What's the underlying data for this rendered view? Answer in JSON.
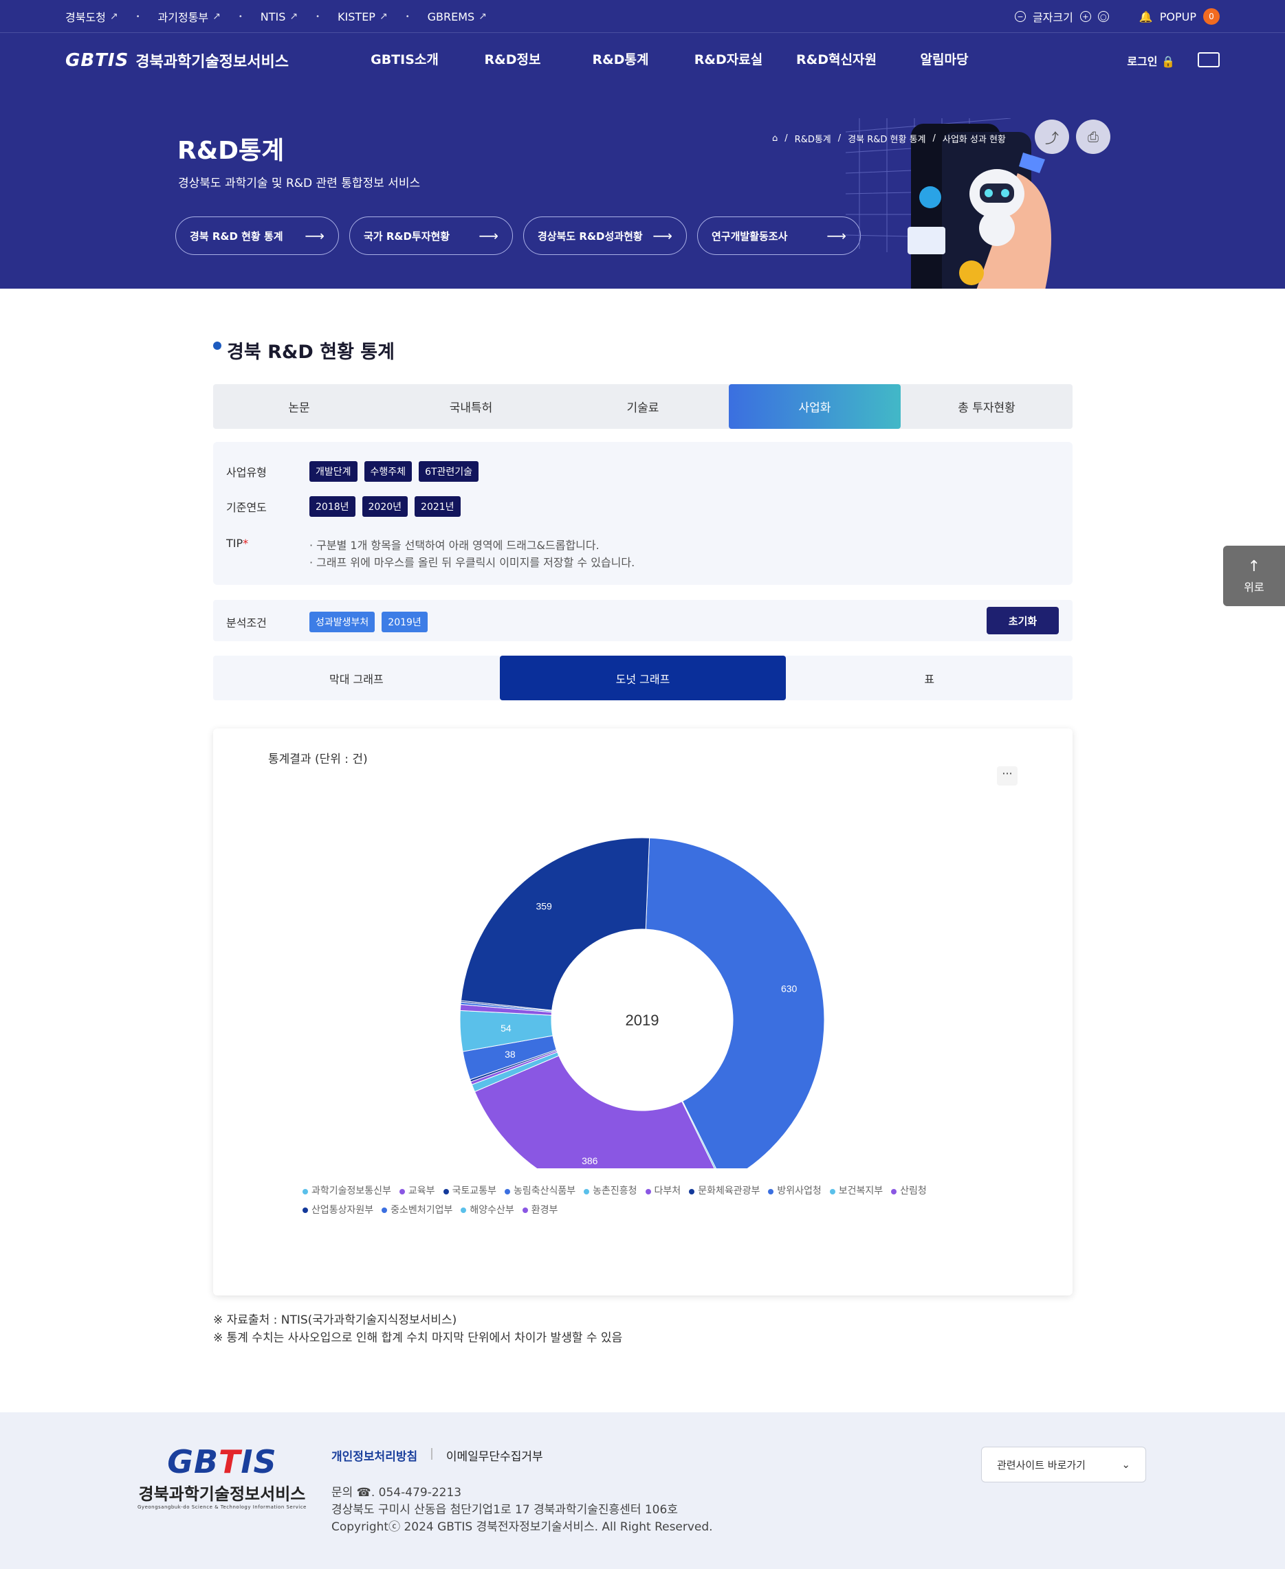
{
  "util_links": [
    "경북도청",
    "과기정통부",
    "NTIS",
    "KISTEP",
    "GBREMS"
  ],
  "font_size_label": "글자크기",
  "popup": {
    "label": "POPUP",
    "count": "0"
  },
  "logo": {
    "mark": "GBTIS",
    "text": "경북과학기술정보서비스"
  },
  "menu": [
    "GBTIS소개",
    "R&D정보",
    "R&D통계",
    "R&D자료실",
    "R&D혁신자원",
    "알림마당"
  ],
  "login": "로그인",
  "hero": {
    "title": "R&D통계",
    "subtitle": "경상북도 과학기술 및 R&D 관련 통합정보 서비스",
    "pills": [
      "경북 R&D 현황 통계",
      "국가 R&D투자현황",
      "경상북도 R&D성과현황",
      "연구개발활동조사"
    ],
    "breadcrumb": [
      "R&D통계",
      "경북 R&D 현황 통계",
      "사업화 성과 현황"
    ]
  },
  "section_title": "경북 R&D 현황 통계",
  "tabs": [
    "논문",
    "국내특허",
    "기술료",
    "사업화",
    "총 투자현황"
  ],
  "active_tab": "사업화",
  "filters": {
    "type_label": "사업유형",
    "types": [
      "개발단계",
      "수행주체",
      "6T관련기술"
    ],
    "year_label": "기준연도",
    "years": [
      "2018년",
      "2020년",
      "2021년"
    ],
    "tip_label": "TIP",
    "tips": [
      "· 구분별 1개 항목을 선택하여 아래 영역에 드래그&드롭합니다.",
      "· 그래프 위에 마우스를 올린 뒤 우클릭시 이미지를 저장할 수 있습니다."
    ]
  },
  "condition": {
    "label": "분석조건",
    "chips": [
      "성과발생부처",
      "2019년"
    ],
    "reset": "초기화"
  },
  "view_tabs": [
    "막대 그래프",
    "도넛 그래프",
    "표"
  ],
  "active_view": "도넛 그래프",
  "chart_title": "통계결과 (단위 : 건)",
  "more_label": "···",
  "chart_data": {
    "type": "pie",
    "center_label": "2019",
    "slices": [
      {
        "name": "과학기술정보통신부",
        "value": 630,
        "color": "#3b6fe0",
        "label": "630"
      },
      {
        "name": "교육부",
        "value": 2,
        "color": "#5ac0ea"
      },
      {
        "name": "",
        "value": 386,
        "color": "#8a57e3",
        "label": "386"
      },
      {
        "name": "국토교통부",
        "value": 10,
        "color": "#5ac0ea"
      },
      {
        "name": "농림축산식품부",
        "value": 4,
        "color": "#8a57e3"
      },
      {
        "name": "농촌진흥청",
        "value": 3,
        "color": "#13399a"
      },
      {
        "name": "다부처",
        "value": 38,
        "color": "#3b6fe0",
        "label": "38"
      },
      {
        "name": "문화체육관광부",
        "value": 54,
        "color": "#5ac0ea",
        "label": "54"
      },
      {
        "name": "방위사업청",
        "value": 8,
        "color": "#8a57e3"
      },
      {
        "name": "보건복지부",
        "value": 3,
        "color": "#3b6fe0"
      },
      {
        "name": "산림청",
        "value": 2,
        "color": "#13399a"
      },
      {
        "name": "산업통상자원부",
        "value": 359,
        "color": "#13399a",
        "label": "359"
      }
    ],
    "legend": [
      {
        "name": "과학기술정보통신부",
        "color": "#5ac0ea"
      },
      {
        "name": "교육부",
        "color": "#8a57e3"
      },
      {
        "name": "국토교통부",
        "color": "#13399a"
      },
      {
        "name": "농림축산식품부",
        "color": "#3b6fe0"
      },
      {
        "name": "농촌진흥청",
        "color": "#5ac0ea"
      },
      {
        "name": "다부처",
        "color": "#8a57e3"
      },
      {
        "name": "문화체육관광부",
        "color": "#13399a"
      },
      {
        "name": "방위사업청",
        "color": "#3b6fe0"
      },
      {
        "name": "보건복지부",
        "color": "#5ac0ea"
      },
      {
        "name": "산림청",
        "color": "#8a57e3"
      },
      {
        "name": "산업통상자원부",
        "color": "#13399a"
      },
      {
        "name": "중소벤처기업부",
        "color": "#3b6fe0"
      },
      {
        "name": "해양수산부",
        "color": "#5ac0ea"
      },
      {
        "name": "환경부",
        "color": "#8a57e3"
      }
    ]
  },
  "notes": [
    "※ 자료출처 : NTIS(국가과학기술지식정보서비스)",
    "※ 통계 수치는 사사오입으로 인해 합계 수치 마지막 단위에서 차이가 발생할 수 있음"
  ],
  "gotop": "위로",
  "footer": {
    "logo_mark_blue": "GB",
    "logo_mark_red": "T",
    "logo_mark_rest": "IS",
    "logo_text": "경북과학기술정보서비스",
    "logo_en": "Gyeongsangbuk-do Science & Technology Information Service",
    "links": [
      "개인정보처리방침",
      "이메일무단수집거부"
    ],
    "phone": "문의 ☎. 054-479-2213",
    "address": "경상북도 구미시 산동읍 첨단기업1로 17 경북과학기술진흥센터 106호",
    "copyright": "Copyrightⓒ 2024 GBTIS 경북전자정보기술서비스. All Right Reserved.",
    "related": "관련사이트 바로가기"
  }
}
